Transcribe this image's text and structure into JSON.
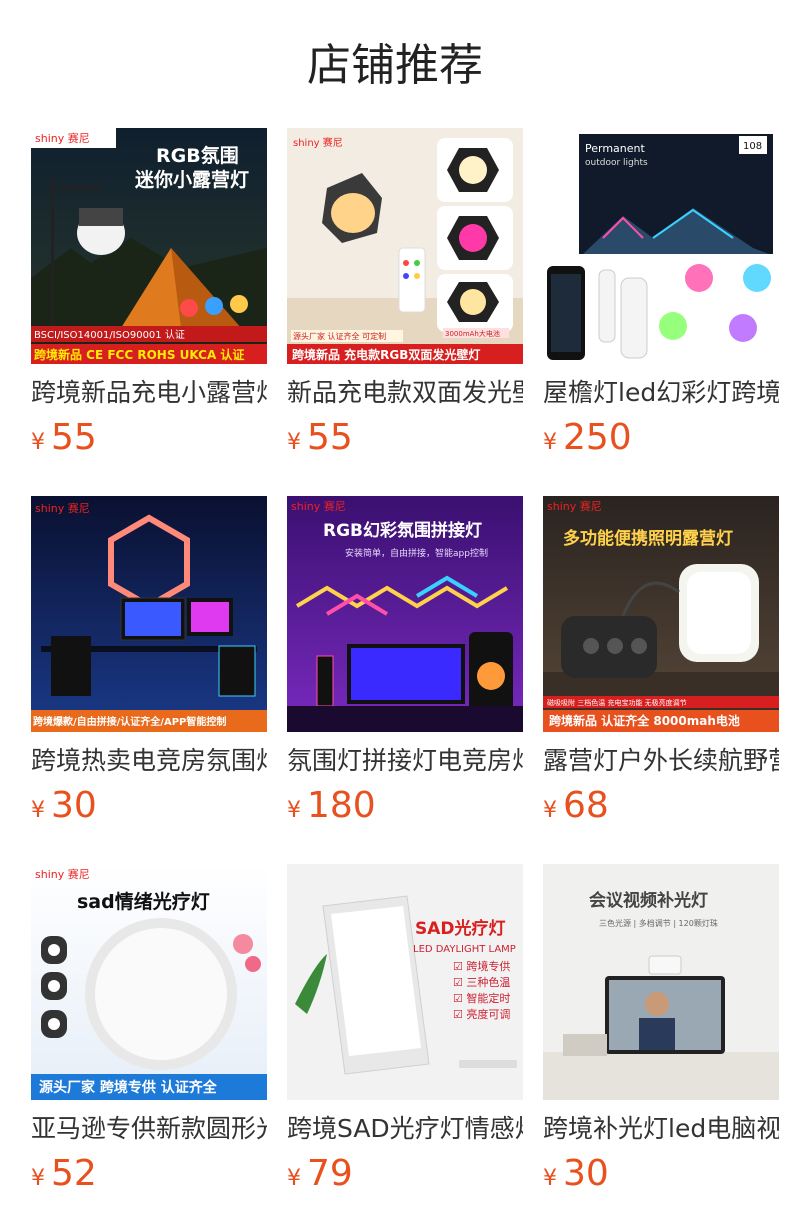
{
  "section": {
    "title": "店铺推荐"
  },
  "products": [
    {
      "name": "跨境新品充电小露营灯",
      "currency": "¥",
      "price": "55",
      "img": {
        "brand": "shiny 赛尼",
        "headline1": "RGB氛围",
        "headline2": "迷你小露营灯",
        "cert": "BSCI/ISO14001/ISO90001 认证",
        "footer": "跨境新品 CE FCC ROHS UKCA 认证"
      }
    },
    {
      "name": "新品充电款双面发光壁灯",
      "currency": "¥",
      "price": "55",
      "img": {
        "brand": "shiny 赛尼",
        "tag1": "源头厂家 认证齐全 可定制",
        "tag2": "3000mAh大电池",
        "footer": "跨境新品  充电款RGB双面发光壁灯"
      }
    },
    {
      "name": "屋檐灯led幻彩灯跨境",
      "currency": "¥",
      "price": "250",
      "img": {
        "box_line1": "Permanent",
        "box_line2": "outdoor lights",
        "box_badge": "108"
      }
    },
    {
      "name": "跨境热卖电竞房氛围灯",
      "currency": "¥",
      "price": "30",
      "img": {
        "brand": "shiny 赛尼",
        "footer": "跨境爆款/自由拼接/认证齐全/APP智能控制"
      }
    },
    {
      "name": "氛围灯拼接灯电竞房灯",
      "currency": "¥",
      "price": "180",
      "img": {
        "brand": "shiny 赛尼",
        "headline": "RGB幻彩氛围拼接灯",
        "sub": "安装简单，自由拼接，智能app控制"
      }
    },
    {
      "name": "露营灯户外长续航野营灯",
      "currency": "¥",
      "price": "68",
      "img": {
        "brand": "shiny 赛尼",
        "headline": "多功能便携照明露营灯",
        "tag": "磁吸吸附 三档色温 充电宝功能 无极亮度调节",
        "footer": "跨境新品  认证齐全  8000mah电池"
      }
    },
    {
      "name": "亚马逊专供新款圆形光疗灯",
      "currency": "¥",
      "price": "52",
      "img": {
        "brand": "shiny 赛尼",
        "headline": "sad情绪光疗灯",
        "footer": "源头厂家  跨境专供  认证齐全"
      }
    },
    {
      "name": "跨境SAD光疗灯情感灯",
      "currency": "¥",
      "price": "79",
      "img": {
        "headline": "SAD光疗灯",
        "sub": "LED DAYLIGHT LAMP",
        "features": [
          "☑ 跨境专供",
          "☑ 三种色温",
          "☑ 智能定时",
          "☑ 亮度可调"
        ]
      }
    },
    {
      "name": "跨境补光灯led电脑视频",
      "currency": "¥",
      "price": "30",
      "img": {
        "headline": "会议视频补光灯",
        "sub": "三色光源 | 多档调节 | 120颗灯珠"
      }
    }
  ],
  "colors": {
    "price": "#e8501e",
    "text": "#333333",
    "title": "#222222"
  }
}
